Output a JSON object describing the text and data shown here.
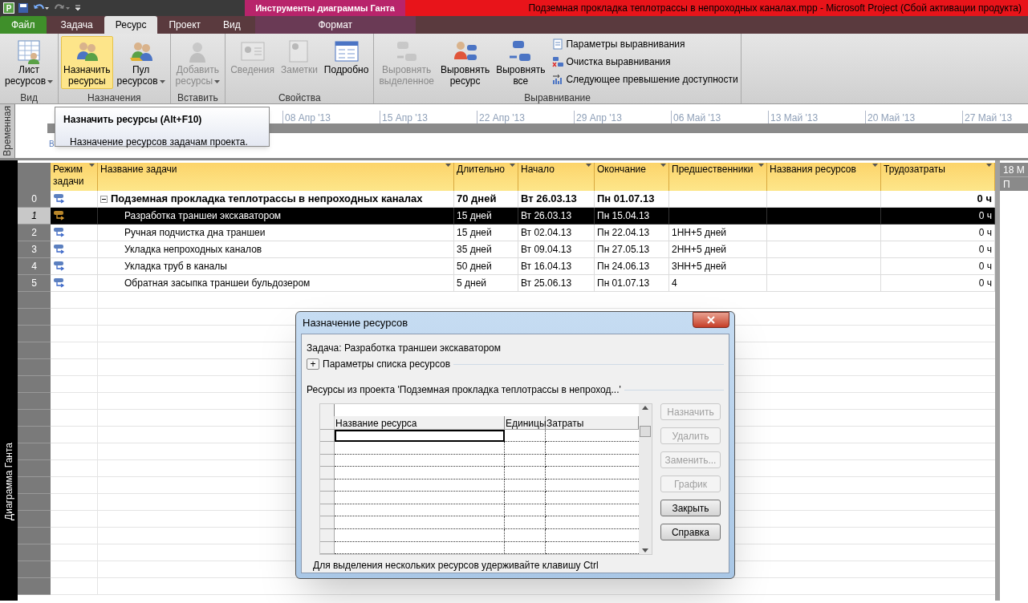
{
  "title_bar": {
    "context_title": "Инструменты диаграммы Ганта",
    "title": "Подземная прокладка теплотрассы в непроходных каналах.mpp  -  Microsoft Project (Сбой активации продукта)",
    "app_letter": "P"
  },
  "tabs": [
    {
      "label": "Файл",
      "kind": "file",
      "selected": false
    },
    {
      "label": "Задача",
      "kind": "tab",
      "selected": false
    },
    {
      "label": "Ресурс",
      "kind": "tab",
      "selected": true
    },
    {
      "label": "Проект",
      "kind": "tab",
      "selected": false
    },
    {
      "label": "Вид",
      "kind": "tab",
      "selected": false
    },
    {
      "label": "Формат",
      "kind": "context",
      "selected": false
    }
  ],
  "ribbon": {
    "groups": [
      {
        "label": "Вид",
        "buttons": [
          {
            "label": "Лист\nресурсов",
            "dropdown": true,
            "disabled": false,
            "highlighted": false
          }
        ]
      },
      {
        "label": "Назначения",
        "buttons": [
          {
            "label": "Назначить\nресурсы",
            "dropdown": false,
            "disabled": false,
            "highlighted": true
          },
          {
            "label": "Пул\nресурсов",
            "dropdown": true,
            "disabled": false,
            "highlighted": false
          }
        ]
      },
      {
        "label": "Вставить",
        "buttons": [
          {
            "label": "Добавить\nресурсы",
            "dropdown": true,
            "disabled": true,
            "highlighted": false
          }
        ]
      },
      {
        "label": "Свойства",
        "buttons": [
          {
            "label": "Сведения",
            "dropdown": false,
            "disabled": true,
            "highlighted": false
          },
          {
            "label": "Заметки",
            "dropdown": false,
            "disabled": true,
            "highlighted": false
          },
          {
            "label": "Подробно",
            "dropdown": false,
            "disabled": false,
            "highlighted": false
          }
        ]
      },
      {
        "label": "Выравнивание",
        "buttons": [
          {
            "label": "Выровнять\nвыделенное",
            "dropdown": false,
            "disabled": true,
            "highlighted": false
          },
          {
            "label": "Выровнять\nресурс",
            "dropdown": false,
            "disabled": false,
            "highlighted": false
          },
          {
            "label": "Выровнять\nвсе",
            "dropdown": false,
            "disabled": false,
            "highlighted": false
          }
        ],
        "small_buttons": [
          "Параметры выравнивания",
          "Очистка выравнивания",
          "Следующее превышение доступности"
        ]
      }
    ]
  },
  "timeline": {
    "side_label": "Временная",
    "start_label": "В",
    "dates": [
      "08 Апр '13",
      "15 Апр '13",
      "22 Апр '13",
      "29 Апр '13",
      "06 Май '13",
      "13 Май '13",
      "20 Май '13",
      "27 Май '13"
    ]
  },
  "tooltip": {
    "title": "Назначить ресурсы (Alt+F10)",
    "description": "Назначение ресурсов задачам проекта."
  },
  "view_label": "Диаграмма Ганта",
  "table": {
    "columns": [
      "Режим\nзадачи",
      "Название задачи",
      "Длительно",
      "Начало",
      "Окончание",
      "Предшественники",
      "Названия ресурсов",
      "Трудозатраты"
    ],
    "rows": [
      {
        "id": "0",
        "summary": true,
        "expanded": true,
        "selected": false,
        "name": "Подземная прокладка теплотрассы в непроходных каналах",
        "duration": "70 дней",
        "start": "Вт 26.03.13",
        "finish": "Пн 01.07.13",
        "work": "0 ч"
      },
      {
        "id": "1",
        "summary": false,
        "selected": true,
        "name": "Разработка траншеи экскаватором",
        "duration": "15 дней",
        "start": "Вт 26.03.13",
        "finish": "Пн 15.04.13",
        "work": "0 ч"
      },
      {
        "id": "2",
        "summary": false,
        "selected": false,
        "name": "Ручная подчистка дна траншеи",
        "duration": "15 дней",
        "start": "Вт 02.04.13",
        "finish": "Пн 22.04.13",
        "predecessors": "1НН+5 дней",
        "work": "0 ч"
      },
      {
        "id": "3",
        "summary": false,
        "selected": false,
        "name": "Укладка непроходных каналов",
        "duration": "35 дней",
        "start": "Вт 09.04.13",
        "finish": "Пн 27.05.13",
        "predecessors": "2НН+5 дней",
        "work": "0 ч"
      },
      {
        "id": "4",
        "summary": false,
        "selected": false,
        "name": "Укладка труб в каналы",
        "duration": "50 дней",
        "start": "Вт 16.04.13",
        "finish": "Пн 24.06.13",
        "predecessors": "3НН+5 дней",
        "work": "0 ч"
      },
      {
        "id": "5",
        "summary": false,
        "selected": false,
        "name": "Обратная засыпка траншеи бульдозером",
        "duration": "5 дней",
        "start": "Вт 25.06.13",
        "finish": "Пн 01.07.13",
        "predecessors": "4",
        "work": "0 ч"
      }
    ]
  },
  "gantt": {
    "period": "18 М",
    "day": "П"
  },
  "dialog": {
    "title": "Назначение ресурсов",
    "task": "Задача: Разработка траншеи экскаватором",
    "options": {
      "expander": "+",
      "label": "Параметры списка ресурсов",
      "expanded": false
    },
    "resources_label": "Ресурсы из проекта 'Подземная прокладка теплотрассы в непроход...'",
    "columns": [
      "Название ресурса",
      "Единицы",
      "Затраты"
    ],
    "buttons": [
      {
        "label": "Назначить",
        "disabled": true
      },
      {
        "label": "Удалить",
        "disabled": true
      },
      {
        "label": "Заменить...",
        "disabled": true
      },
      {
        "label": "График",
        "disabled": true
      },
      {
        "label": "Закрыть",
        "disabled": false
      },
      {
        "label": "Справка",
        "disabled": false
      }
    ],
    "hint": "Для выделения нескольких ресурсов удерживайте клавишу Ctrl"
  }
}
